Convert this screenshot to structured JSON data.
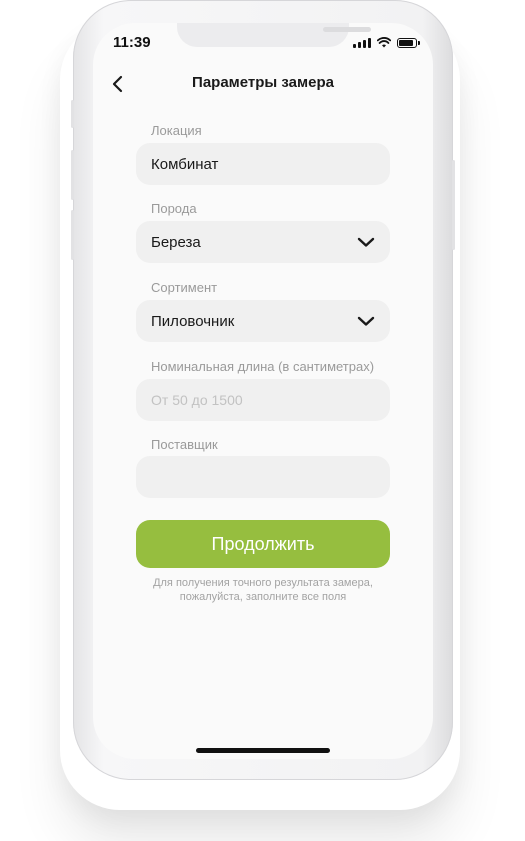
{
  "status_bar": {
    "time": "11:39"
  },
  "header": {
    "title": "Параметры замера"
  },
  "form": {
    "location": {
      "label": "Локация",
      "value": "Комбинат"
    },
    "species": {
      "label": "Порода",
      "value": "Береза"
    },
    "assortment": {
      "label": "Сортимент",
      "value": "Пиловочник"
    },
    "length": {
      "label": "Номинальная длина (в сантиметрах)",
      "value": "",
      "placeholder": "От 50 до 1500"
    },
    "supplier": {
      "label": "Поставщик",
      "value": ""
    }
  },
  "actions": {
    "continue_label": "Продолжить"
  },
  "hint": {
    "line1": "Для получения точного результата замера,",
    "line2": "пожалуйста, заполните все поля"
  },
  "colors": {
    "accent": "#96be3f",
    "field_bg": "#f0f0f0",
    "screen_bg": "#fafafa"
  },
  "icons": {
    "back": "chevron-left-icon",
    "dropdown": "chevron-down-icon"
  }
}
